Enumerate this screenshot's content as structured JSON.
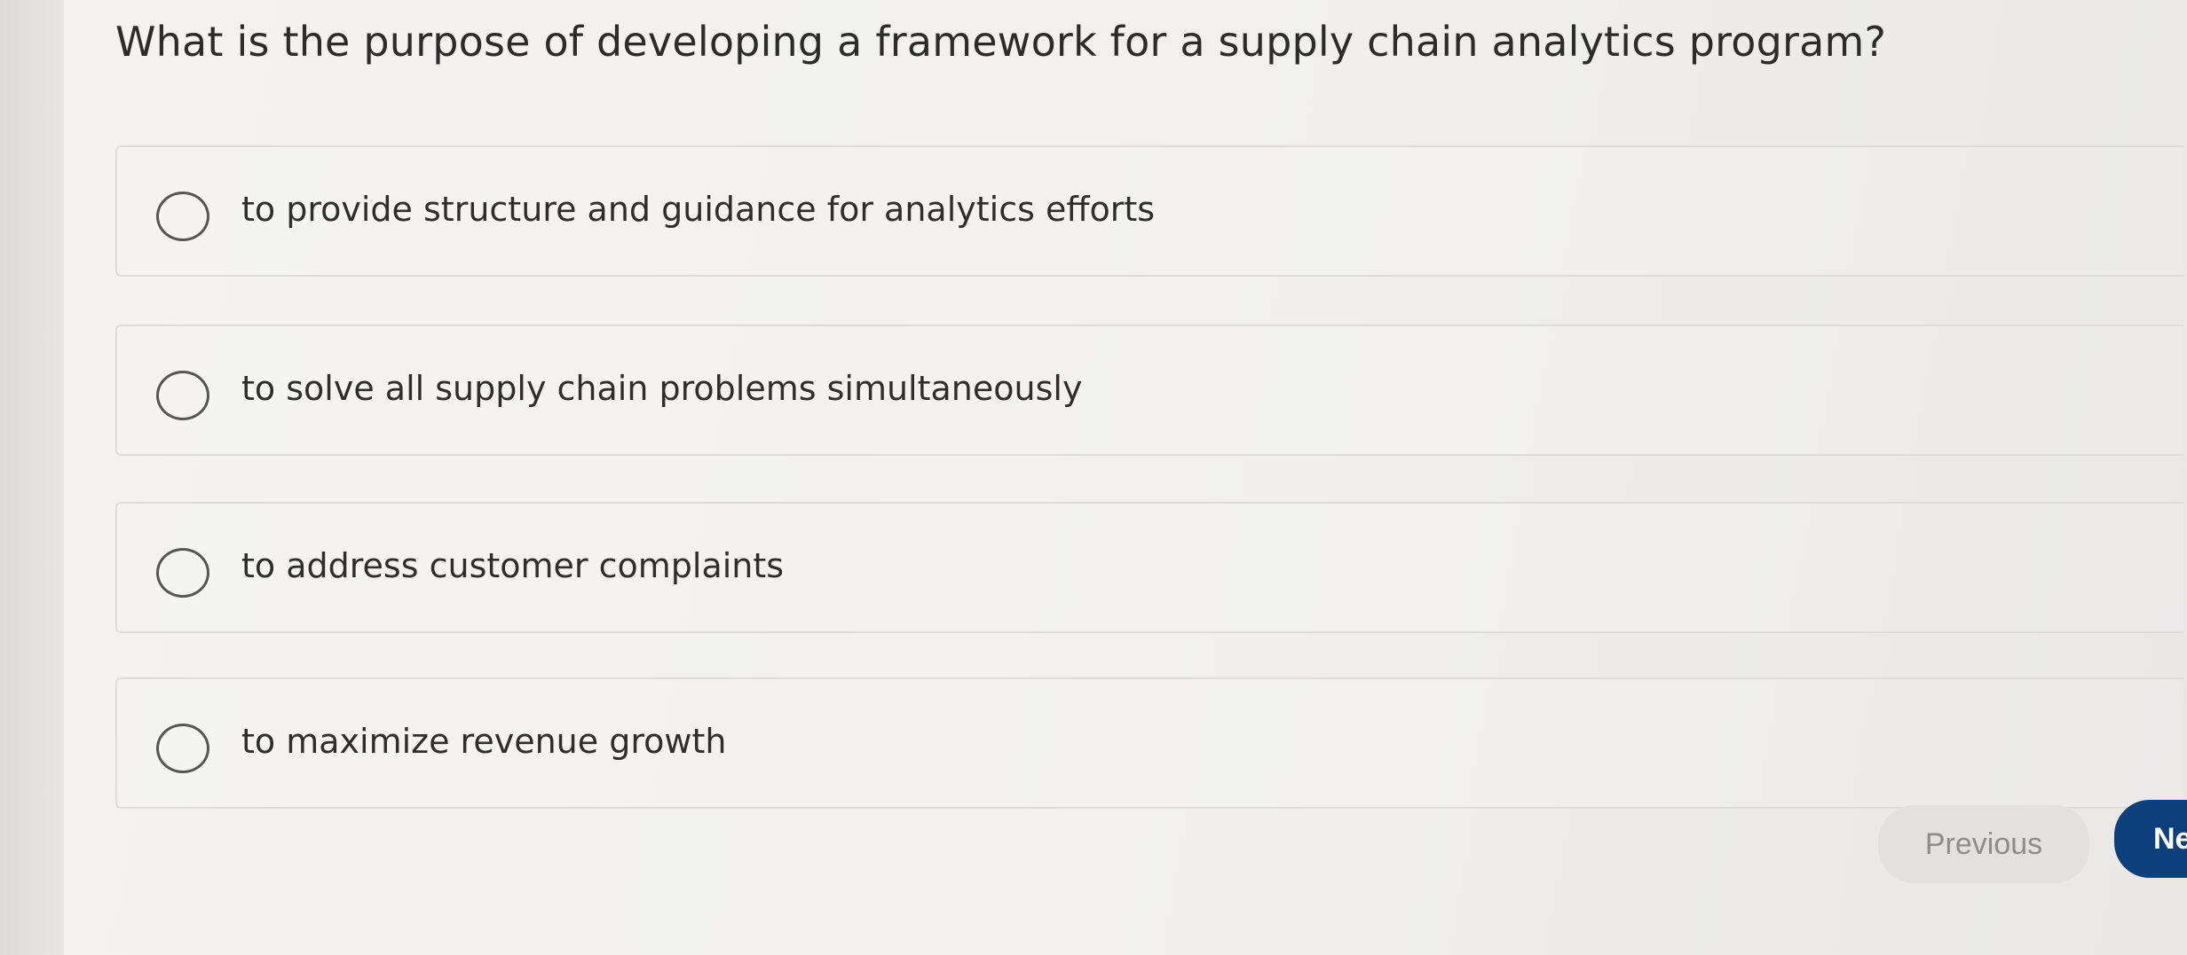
{
  "question": {
    "text": "What is the purpose of developing a framework for a supply chain analytics program?"
  },
  "options": [
    {
      "label": "to provide structure and guidance for analytics efforts",
      "selected": false
    },
    {
      "label": "to solve all supply chain problems simultaneously",
      "selected": false
    },
    {
      "label": "to address customer complaints",
      "selected": false
    },
    {
      "label": "to maximize revenue growth",
      "selected": false
    }
  ],
  "navigation": {
    "previous_label": "Previous",
    "next_label": "Ne"
  },
  "colors": {
    "next_button": "#0d3f7a",
    "previous_button": "#e2e1df"
  }
}
